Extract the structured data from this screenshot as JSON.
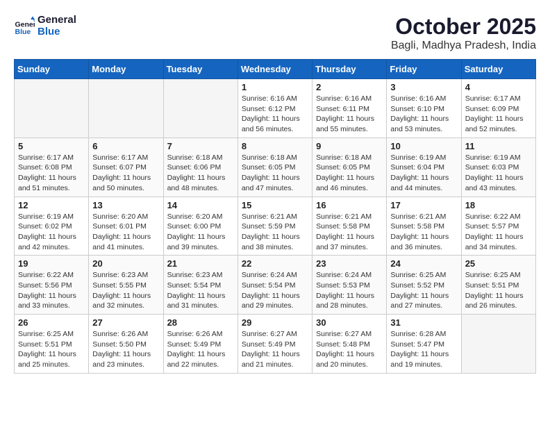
{
  "logo": {
    "line1": "General",
    "line2": "Blue"
  },
  "title": "October 2025",
  "location": "Bagli, Madhya Pradesh, India",
  "weekdays": [
    "Sunday",
    "Monday",
    "Tuesday",
    "Wednesday",
    "Thursday",
    "Friday",
    "Saturday"
  ],
  "weeks": [
    [
      {
        "day": "",
        "info": ""
      },
      {
        "day": "",
        "info": ""
      },
      {
        "day": "",
        "info": ""
      },
      {
        "day": "1",
        "info": "Sunrise: 6:16 AM\nSunset: 6:12 PM\nDaylight: 11 hours\nand 56 minutes."
      },
      {
        "day": "2",
        "info": "Sunrise: 6:16 AM\nSunset: 6:11 PM\nDaylight: 11 hours\nand 55 minutes."
      },
      {
        "day": "3",
        "info": "Sunrise: 6:16 AM\nSunset: 6:10 PM\nDaylight: 11 hours\nand 53 minutes."
      },
      {
        "day": "4",
        "info": "Sunrise: 6:17 AM\nSunset: 6:09 PM\nDaylight: 11 hours\nand 52 minutes."
      }
    ],
    [
      {
        "day": "5",
        "info": "Sunrise: 6:17 AM\nSunset: 6:08 PM\nDaylight: 11 hours\nand 51 minutes."
      },
      {
        "day": "6",
        "info": "Sunrise: 6:17 AM\nSunset: 6:07 PM\nDaylight: 11 hours\nand 50 minutes."
      },
      {
        "day": "7",
        "info": "Sunrise: 6:18 AM\nSunset: 6:06 PM\nDaylight: 11 hours\nand 48 minutes."
      },
      {
        "day": "8",
        "info": "Sunrise: 6:18 AM\nSunset: 6:05 PM\nDaylight: 11 hours\nand 47 minutes."
      },
      {
        "day": "9",
        "info": "Sunrise: 6:18 AM\nSunset: 6:05 PM\nDaylight: 11 hours\nand 46 minutes."
      },
      {
        "day": "10",
        "info": "Sunrise: 6:19 AM\nSunset: 6:04 PM\nDaylight: 11 hours\nand 44 minutes."
      },
      {
        "day": "11",
        "info": "Sunrise: 6:19 AM\nSunset: 6:03 PM\nDaylight: 11 hours\nand 43 minutes."
      }
    ],
    [
      {
        "day": "12",
        "info": "Sunrise: 6:19 AM\nSunset: 6:02 PM\nDaylight: 11 hours\nand 42 minutes."
      },
      {
        "day": "13",
        "info": "Sunrise: 6:20 AM\nSunset: 6:01 PM\nDaylight: 11 hours\nand 41 minutes."
      },
      {
        "day": "14",
        "info": "Sunrise: 6:20 AM\nSunset: 6:00 PM\nDaylight: 11 hours\nand 39 minutes."
      },
      {
        "day": "15",
        "info": "Sunrise: 6:21 AM\nSunset: 5:59 PM\nDaylight: 11 hours\nand 38 minutes."
      },
      {
        "day": "16",
        "info": "Sunrise: 6:21 AM\nSunset: 5:58 PM\nDaylight: 11 hours\nand 37 minutes."
      },
      {
        "day": "17",
        "info": "Sunrise: 6:21 AM\nSunset: 5:58 PM\nDaylight: 11 hours\nand 36 minutes."
      },
      {
        "day": "18",
        "info": "Sunrise: 6:22 AM\nSunset: 5:57 PM\nDaylight: 11 hours\nand 34 minutes."
      }
    ],
    [
      {
        "day": "19",
        "info": "Sunrise: 6:22 AM\nSunset: 5:56 PM\nDaylight: 11 hours\nand 33 minutes."
      },
      {
        "day": "20",
        "info": "Sunrise: 6:23 AM\nSunset: 5:55 PM\nDaylight: 11 hours\nand 32 minutes."
      },
      {
        "day": "21",
        "info": "Sunrise: 6:23 AM\nSunset: 5:54 PM\nDaylight: 11 hours\nand 31 minutes."
      },
      {
        "day": "22",
        "info": "Sunrise: 6:24 AM\nSunset: 5:54 PM\nDaylight: 11 hours\nand 29 minutes."
      },
      {
        "day": "23",
        "info": "Sunrise: 6:24 AM\nSunset: 5:53 PM\nDaylight: 11 hours\nand 28 minutes."
      },
      {
        "day": "24",
        "info": "Sunrise: 6:25 AM\nSunset: 5:52 PM\nDaylight: 11 hours\nand 27 minutes."
      },
      {
        "day": "25",
        "info": "Sunrise: 6:25 AM\nSunset: 5:51 PM\nDaylight: 11 hours\nand 26 minutes."
      }
    ],
    [
      {
        "day": "26",
        "info": "Sunrise: 6:25 AM\nSunset: 5:51 PM\nDaylight: 11 hours\nand 25 minutes."
      },
      {
        "day": "27",
        "info": "Sunrise: 6:26 AM\nSunset: 5:50 PM\nDaylight: 11 hours\nand 23 minutes."
      },
      {
        "day": "28",
        "info": "Sunrise: 6:26 AM\nSunset: 5:49 PM\nDaylight: 11 hours\nand 22 minutes."
      },
      {
        "day": "29",
        "info": "Sunrise: 6:27 AM\nSunset: 5:49 PM\nDaylight: 11 hours\nand 21 minutes."
      },
      {
        "day": "30",
        "info": "Sunrise: 6:27 AM\nSunset: 5:48 PM\nDaylight: 11 hours\nand 20 minutes."
      },
      {
        "day": "31",
        "info": "Sunrise: 6:28 AM\nSunset: 5:47 PM\nDaylight: 11 hours\nand 19 minutes."
      },
      {
        "day": "",
        "info": ""
      }
    ]
  ]
}
